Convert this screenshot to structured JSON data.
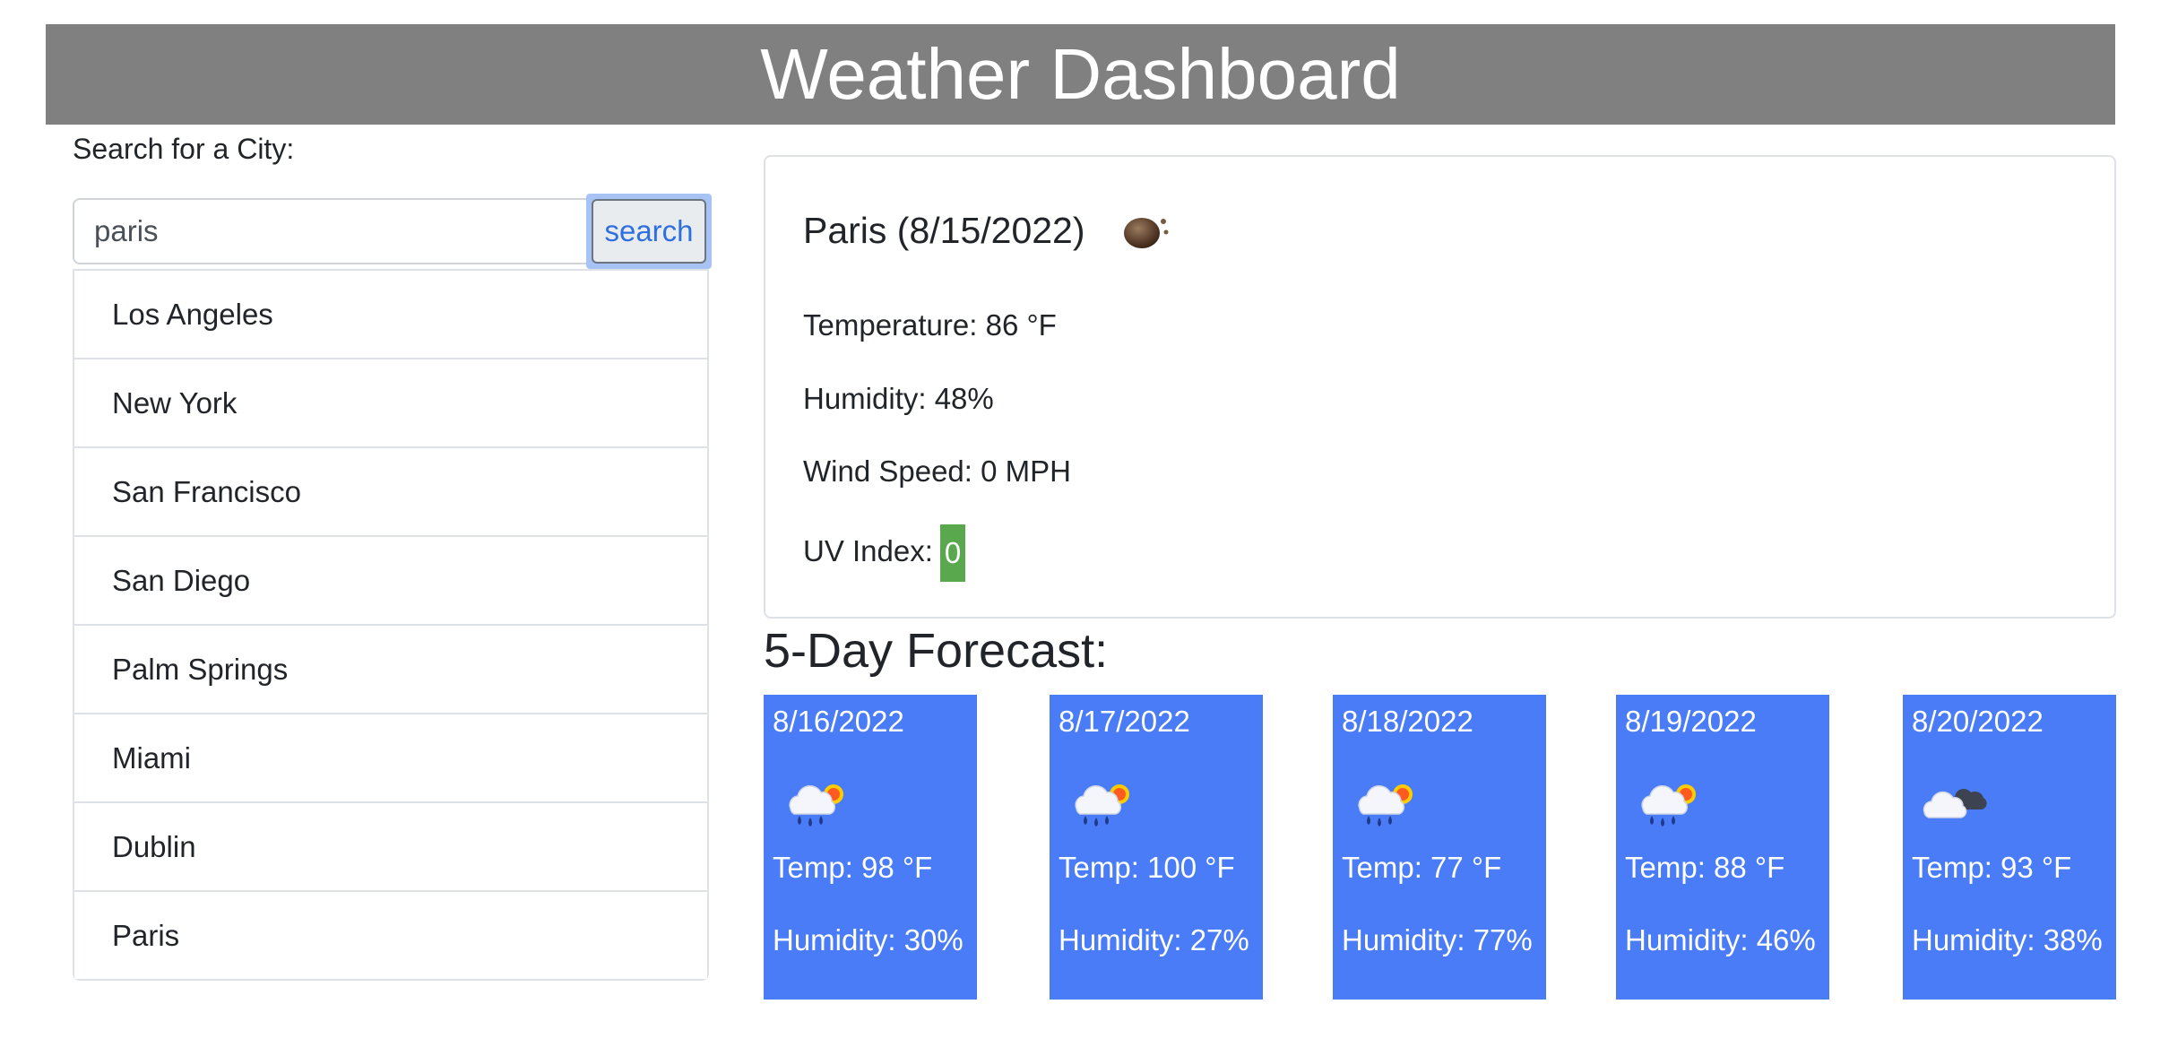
{
  "header": {
    "title": "Weather Dashboard"
  },
  "search": {
    "label": "Search for a City:",
    "input_value": "paris",
    "button_label": "search"
  },
  "cities": [
    "Los Angeles",
    "New York",
    "San Francisco",
    "San Diego",
    "Palm Springs",
    "Miami",
    "Dublin",
    "Paris"
  ],
  "current": {
    "title": "Paris (8/15/2022)",
    "icon": "cloud-night-icon",
    "temperature": "Temperature: 86 °F",
    "humidity": "Humidity: 48%",
    "wind": "Wind Speed: 0 MPH",
    "uv_label": "UV Index:",
    "uv_value": "0",
    "uv_color": "#5aa84e"
  },
  "forecast": {
    "title": "5-Day Forecast:",
    "card_color": "#4a7cf8",
    "days": [
      {
        "date": "8/16/2022",
        "icon": "rain-sun-icon",
        "temp": "Temp: 98 °F",
        "humidity": "Humidity: 30%"
      },
      {
        "date": "8/17/2022",
        "icon": "rain-sun-icon",
        "temp": "Temp: 100 °F",
        "humidity": "Humidity: 27%"
      },
      {
        "date": "8/18/2022",
        "icon": "rain-sun-icon",
        "temp": "Temp: 77 °F",
        "humidity": "Humidity: 77%"
      },
      {
        "date": "8/19/2022",
        "icon": "rain-sun-icon",
        "temp": "Temp: 88 °F",
        "humidity": "Humidity: 46%"
      },
      {
        "date": "8/20/2022",
        "icon": "cloudy-icon",
        "temp": "Temp: 93 °F",
        "humidity": "Humidity: 38%"
      }
    ]
  }
}
